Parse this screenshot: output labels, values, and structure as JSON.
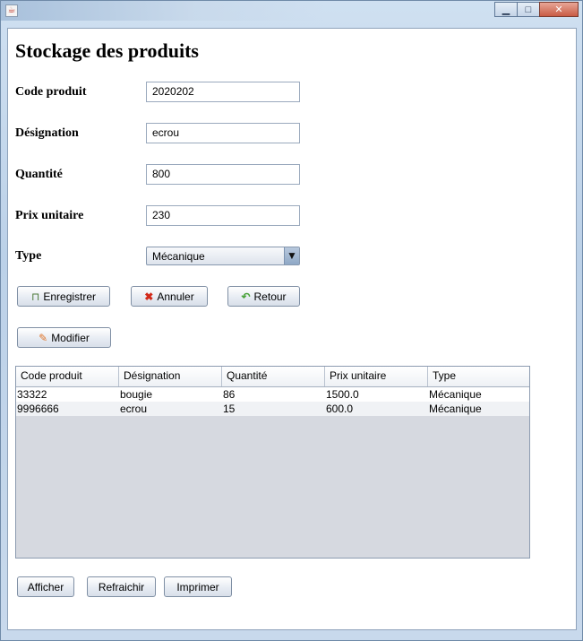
{
  "window": {
    "title": "",
    "minimize_glyph": "▭",
    "maximize_glyph": "□",
    "close_glyph": "✕"
  },
  "form": {
    "heading": "Stockage des produits",
    "code_label": "Code produit",
    "code_value": "2020202",
    "designation_label": "Désignation",
    "designation_value": "ecrou",
    "quantite_label": "Quantité",
    "quantite_value": "800",
    "prix_label": "Prix unitaire",
    "prix_value": "230",
    "type_label": "Type",
    "type_value": "Mécanique"
  },
  "buttons": {
    "enregistrer": "Enregistrer",
    "annuler": "Annuler",
    "retour": "Retour",
    "modifier": "Modifier",
    "afficher": "Afficher",
    "refraichir": "Refraichir",
    "imprimer": "Imprimer"
  },
  "table": {
    "columns": [
      "Code produit",
      "Désignation",
      "Quantité",
      "Prix unitaire",
      "Type"
    ],
    "rows": [
      [
        "33322",
        "bougie",
        "86",
        "1500.0",
        "Mécanique"
      ],
      [
        "9996666",
        "ecrou",
        "15",
        "600.0",
        "Mécanique"
      ]
    ]
  },
  "colors": {
    "table_empty_area": "#d6d9e0",
    "close_button": "#c95c45"
  }
}
